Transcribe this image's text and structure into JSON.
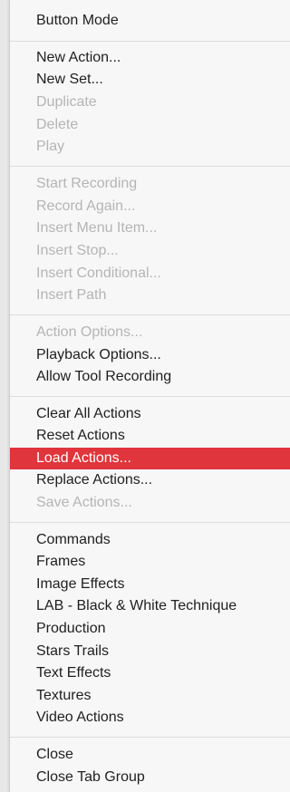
{
  "menu": {
    "items": [
      {
        "label": "Button Mode",
        "enabled": true
      },
      {
        "label": "New Action...",
        "enabled": true
      },
      {
        "label": "New Set...",
        "enabled": true
      },
      {
        "label": "Duplicate",
        "enabled": false
      },
      {
        "label": "Delete",
        "enabled": false
      },
      {
        "label": "Play",
        "enabled": false
      },
      {
        "label": "Start Recording",
        "enabled": false
      },
      {
        "label": "Record Again...",
        "enabled": false
      },
      {
        "label": "Insert Menu Item...",
        "enabled": false
      },
      {
        "label": "Insert Stop...",
        "enabled": false
      },
      {
        "label": "Insert Conditional...",
        "enabled": false
      },
      {
        "label": "Insert Path",
        "enabled": false
      },
      {
        "label": "Action Options...",
        "enabled": false
      },
      {
        "label": "Playback Options...",
        "enabled": true
      },
      {
        "label": "Allow Tool Recording",
        "enabled": true
      },
      {
        "label": "Clear All Actions",
        "enabled": true
      },
      {
        "label": "Reset Actions",
        "enabled": true
      },
      {
        "label": "Load Actions...",
        "enabled": true,
        "highlighted": true
      },
      {
        "label": "Replace Actions...",
        "enabled": true
      },
      {
        "label": "Save Actions...",
        "enabled": false
      },
      {
        "label": "Commands",
        "enabled": true
      },
      {
        "label": "Frames",
        "enabled": true
      },
      {
        "label": "Image Effects",
        "enabled": true
      },
      {
        "label": "LAB - Black & White Technique",
        "enabled": true
      },
      {
        "label": "Production",
        "enabled": true
      },
      {
        "label": "Stars Trails",
        "enabled": true
      },
      {
        "label": "Text Effects",
        "enabled": true
      },
      {
        "label": "Textures",
        "enabled": true
      },
      {
        "label": "Video Actions",
        "enabled": true
      },
      {
        "label": "Close",
        "enabled": true
      },
      {
        "label": "Close Tab Group",
        "enabled": true
      }
    ]
  },
  "colors": {
    "highlight": "#e0353c",
    "text": "#1f1f1f",
    "disabled_text": "#b5b5b5",
    "background": "#f7f7f7"
  }
}
